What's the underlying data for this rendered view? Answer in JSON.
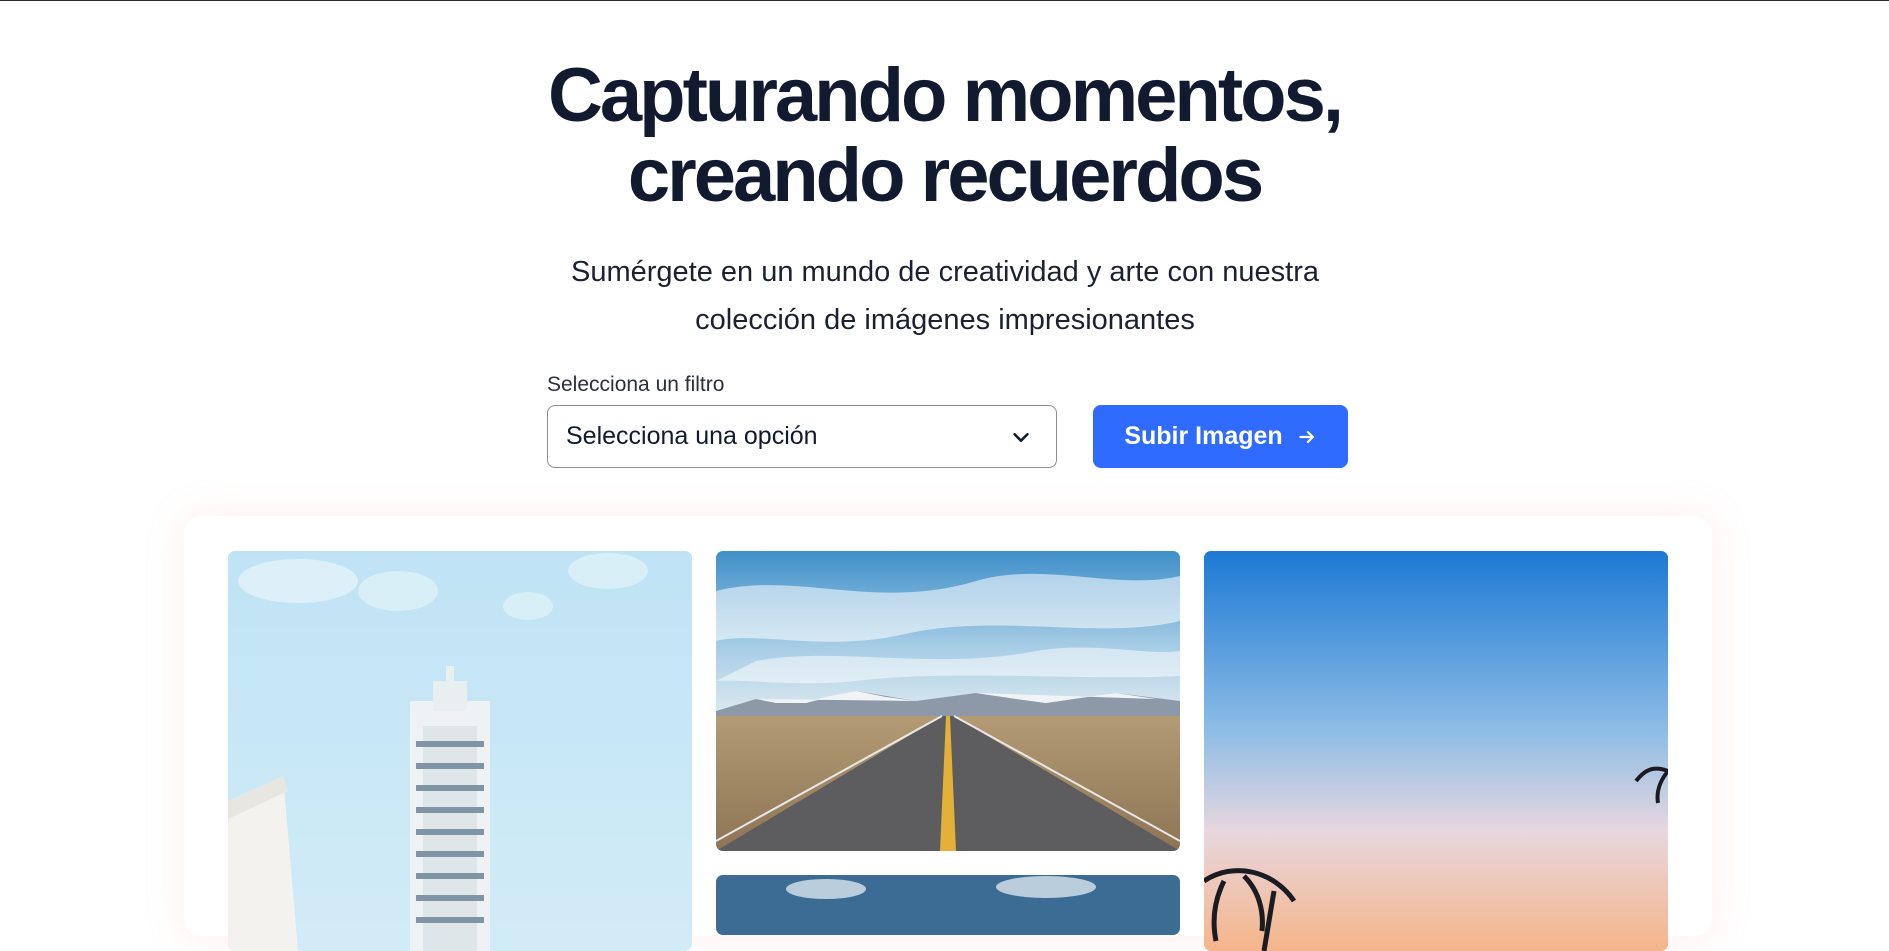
{
  "hero": {
    "title_line1": "Capturando momentos,",
    "title_line2": "creando recuerdos",
    "subtitle_line1": "Sumérgete en un mundo de creatividad y arte con nuestra",
    "subtitle_line2": "colección de imágenes impresionantes"
  },
  "filter": {
    "label": "Selecciona un filtro",
    "selected": "Selecciona una opción",
    "icon": "chevron-down-icon"
  },
  "upload": {
    "label": "Subir Imagen",
    "icon": "arrow-right-icon"
  },
  "colors": {
    "accent": "#2f6bff",
    "heading": "#121a2f",
    "border": "#8c8f96"
  },
  "gallery": {
    "images": [
      "city-tower-photo",
      "desert-road-photo",
      "road-sky-photo",
      "sunset-palms-photo"
    ]
  }
}
